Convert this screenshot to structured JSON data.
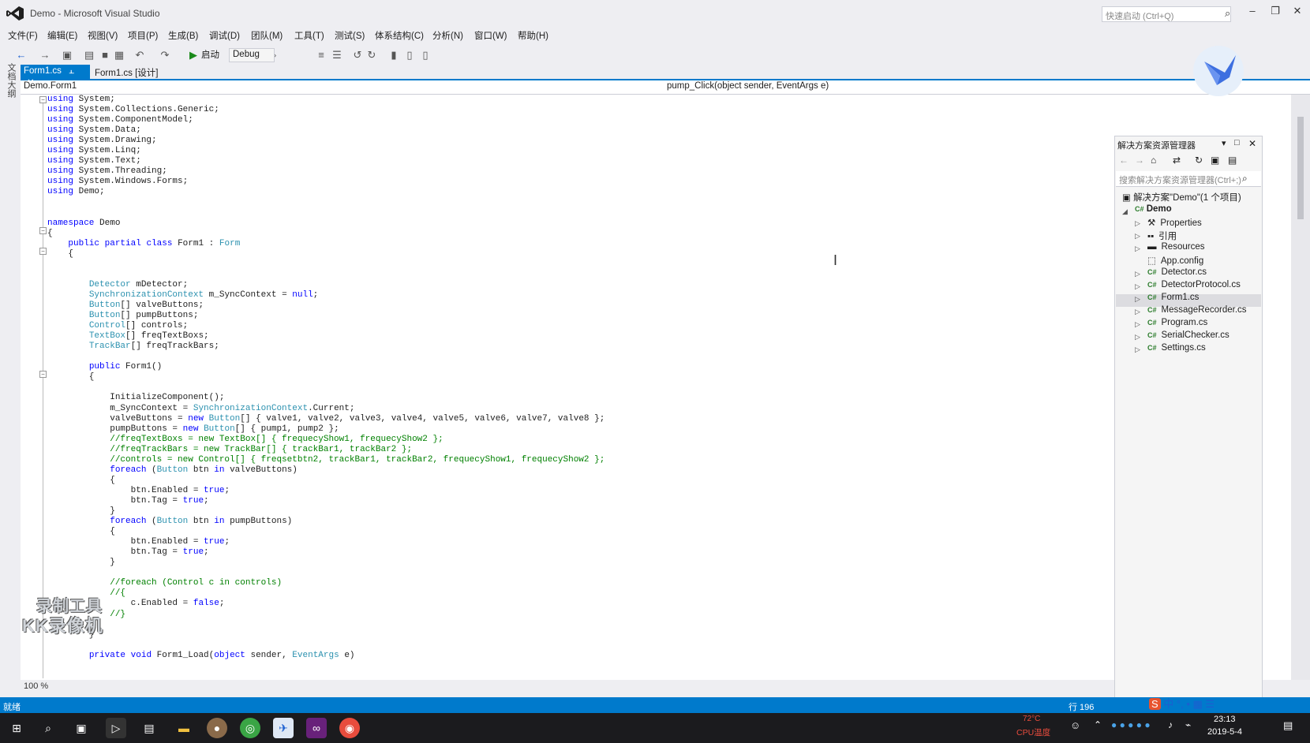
{
  "window": {
    "title": "Demo - Microsoft Visual Studio",
    "quick_launch_placeholder": "快速启动 (Ctrl+Q)"
  },
  "menu": [
    "文件(F)",
    "编辑(E)",
    "视图(V)",
    "项目(P)",
    "生成(B)",
    "调试(D)",
    "团队(M)",
    "工具(T)",
    "测试(S)",
    "体系结构(C)",
    "分析(N)",
    "窗口(W)",
    "帮助(H)"
  ],
  "toolbar": {
    "start_label": "启动",
    "config": "Debug"
  },
  "side_strip_label": "文档大纲",
  "tabs": [
    {
      "label": "Form1.cs"
    },
    {
      "label": "Form1.cs [设计]"
    }
  ],
  "nav": {
    "class_scope": "Demo.Form1",
    "member_scope": "pump_Click(object sender, EventArgs e)"
  },
  "code_lines": [
    "using System;",
    "using System.Collections.Generic;",
    "using System.ComponentModel;",
    "using System.Data;",
    "using System.Drawing;",
    "using System.Linq;",
    "using System.Text;",
    "using System.Threading;",
    "using System.Windows.Forms;",
    "using Demo;",
    "",
    "",
    "namespace Demo",
    "{",
    "    public partial class Form1 : Form",
    "    {",
    "",
    "",
    "        Detector mDetector;",
    "        SynchronizationContext m_SyncContext = null;",
    "        Button[] valveButtons;",
    "        Button[] pumpButtons;",
    "        Control[] controls;",
    "        TextBox[] freqTextBoxs;",
    "        TrackBar[] freqTrackBars;",
    "",
    "        public Form1()",
    "        {",
    "",
    "            InitializeComponent();",
    "            m_SyncContext = SynchronizationContext.Current;",
    "            valveButtons = new Button[] { valve1, valve2, valve3, valve4, valve5, valve6, valve7, valve8 };",
    "            pumpButtons = new Button[] { pump1, pump2 };",
    "            //freqTextBoxs = new TextBox[] { frequecyShow1, frequecyShow2 };",
    "            //freqTrackBars = new TrackBar[] { trackBar1, trackBar2 };",
    "            //controls = new Control[] { freqsetbtn2, trackBar1, trackBar2, frequecyShow1, frequecyShow2 };",
    "            foreach (Button btn in valveButtons)",
    "            {",
    "                btn.Enabled = true;",
    "                btn.Tag = true;",
    "            }",
    "            foreach (Button btn in pumpButtons)",
    "            {",
    "                btn.Enabled = true;",
    "                btn.Tag = true;",
    "            }",
    "",
    "            //foreach (Control c in controls)",
    "            //{",
    "                c.Enabled = false;",
    "            //}",
    "",
    "        }",
    "",
    "        private void Form1_Load(object sender, EventArgs e)"
  ],
  "zoom": "100 %",
  "solution_explorer": {
    "title": "解决方案资源管理器",
    "search_placeholder": "搜索解决方案资源管理器(Ctrl+;)",
    "solution": "解决方案\"Demo\"(1 个项目)",
    "project": "Demo",
    "items": [
      "Properties",
      "引用",
      "Resources",
      "App.config",
      "Detector.cs",
      "DetectorProtocol.cs",
      "Form1.cs",
      "MessageRecorder.cs",
      "Program.cs",
      "SerialChecker.cs",
      "Settings.cs"
    ],
    "selected": "Form1.cs"
  },
  "status": {
    "text": "就绪",
    "line": "行 196"
  },
  "watermark": {
    "line1": "录制工具",
    "line2": "KK录像机"
  },
  "taskbar": {
    "cpu_temp": "72°C",
    "cpu_label": "CPU温度",
    "time": "23:13",
    "date": "2019-5-4"
  },
  "colors": {
    "accent": "#007acc",
    "keyword": "#0000ff",
    "type": "#2b91af",
    "comment": "#008000"
  }
}
